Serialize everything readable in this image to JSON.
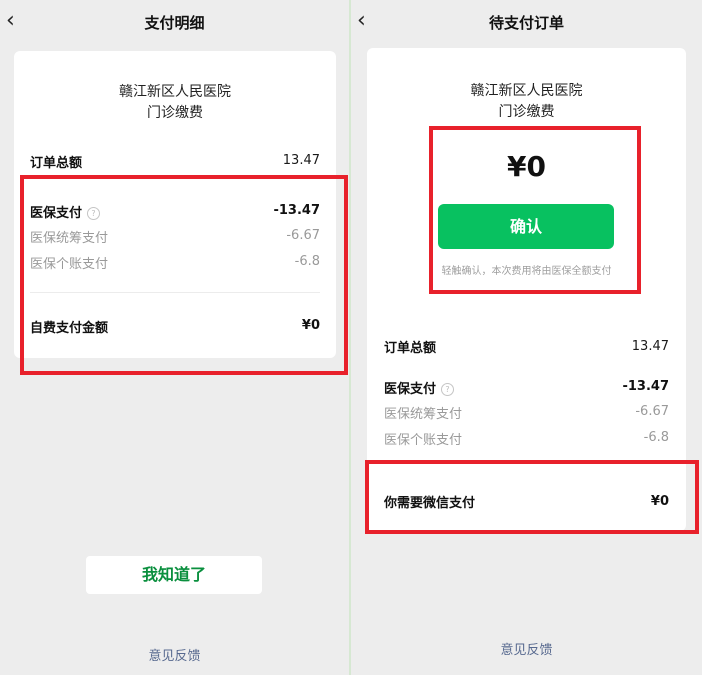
{
  "left": {
    "nav_title": "支付明细",
    "hospital_name": "赣江新区人民医院",
    "bill_type": "门诊缴费",
    "order_total_label": "订单总额",
    "order_total_value": "13.47",
    "insurance_label": "医保支付",
    "insurance_value": "-13.47",
    "pooled_label": "医保统筹支付",
    "pooled_value": "-6.67",
    "personal_label": "医保个账支付",
    "personal_value": "-6.8",
    "self_pay_label": "自费支付金额",
    "self_pay_value": "¥0",
    "got_it_button": "我知道了",
    "feedback_link": "意见反馈"
  },
  "right": {
    "nav_title": "待支付订单",
    "hospital_name": "赣江新区人民医院",
    "bill_type": "门诊缴费",
    "amount": "¥0",
    "confirm_button": "确认",
    "confirm_hint": "轻触确认，本次费用将由医保全额支付",
    "order_total_label": "订单总额",
    "order_total_value": "13.47",
    "insurance_label": "医保支付",
    "insurance_value": "-13.47",
    "pooled_label": "医保统筹支付",
    "pooled_value": "-6.67",
    "personal_label": "医保个账支付",
    "personal_value": "-6.8",
    "wechat_pay_label": "你需要微信支付",
    "wechat_pay_value": "¥0",
    "feedback_link": "意见反馈"
  },
  "icons": {
    "back": "chevron-left-icon",
    "help": "question-circle-icon"
  },
  "colors": {
    "primary_green": "#08c160",
    "dark_green_text": "#0a8f3e",
    "highlight_red": "#e8212b",
    "link_blue": "#57698f",
    "background": "#ededed"
  }
}
